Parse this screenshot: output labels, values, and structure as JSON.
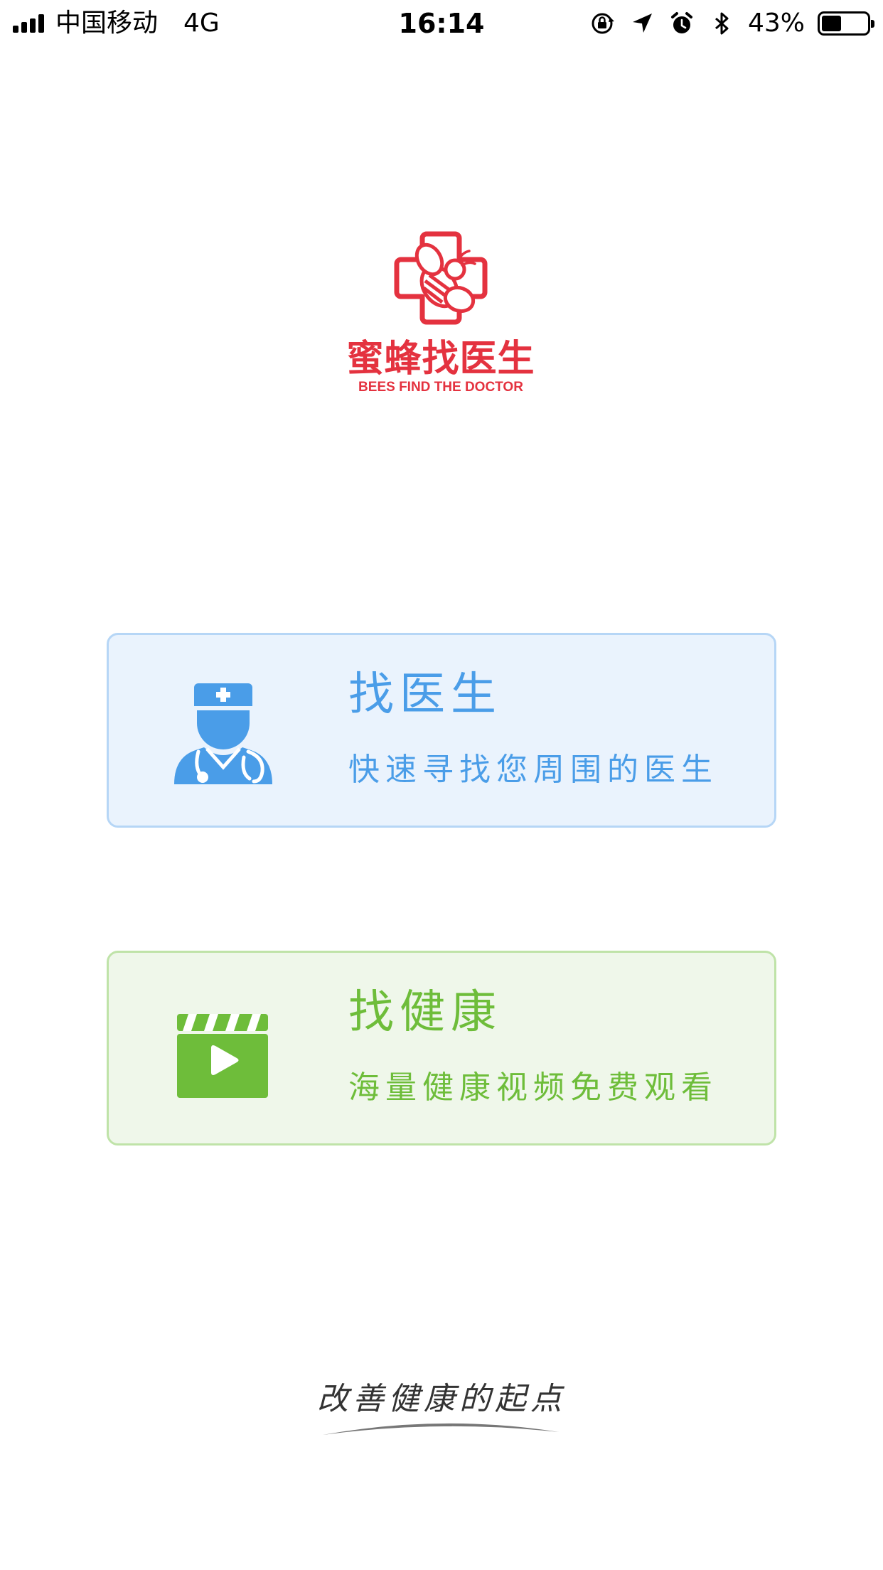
{
  "status_bar": {
    "carrier": "中国移动",
    "network": "4G",
    "time": "16:14",
    "battery_percent_label": "43%",
    "battery_level": 0.43,
    "signal_bars": 4,
    "icons": [
      "orientation-lock-icon",
      "location-arrow-icon",
      "alarm-icon",
      "bluetooth-icon",
      "battery-icon"
    ]
  },
  "logo": {
    "name_cn": "蜜蜂找医生",
    "name_en": "BEES FIND THE DOCTOR",
    "brand_color": "#e4323f"
  },
  "cards": {
    "doctor": {
      "title": "找医生",
      "subtitle": "快速寻找您周围的医生",
      "icon": "doctor-icon",
      "accent": "#4a9de8"
    },
    "health": {
      "title": "找健康",
      "subtitle": "海量健康视频免费观看",
      "icon": "video-clapper-icon",
      "accent": "#6ebd3a"
    }
  },
  "slogan": "改善健康的起点"
}
